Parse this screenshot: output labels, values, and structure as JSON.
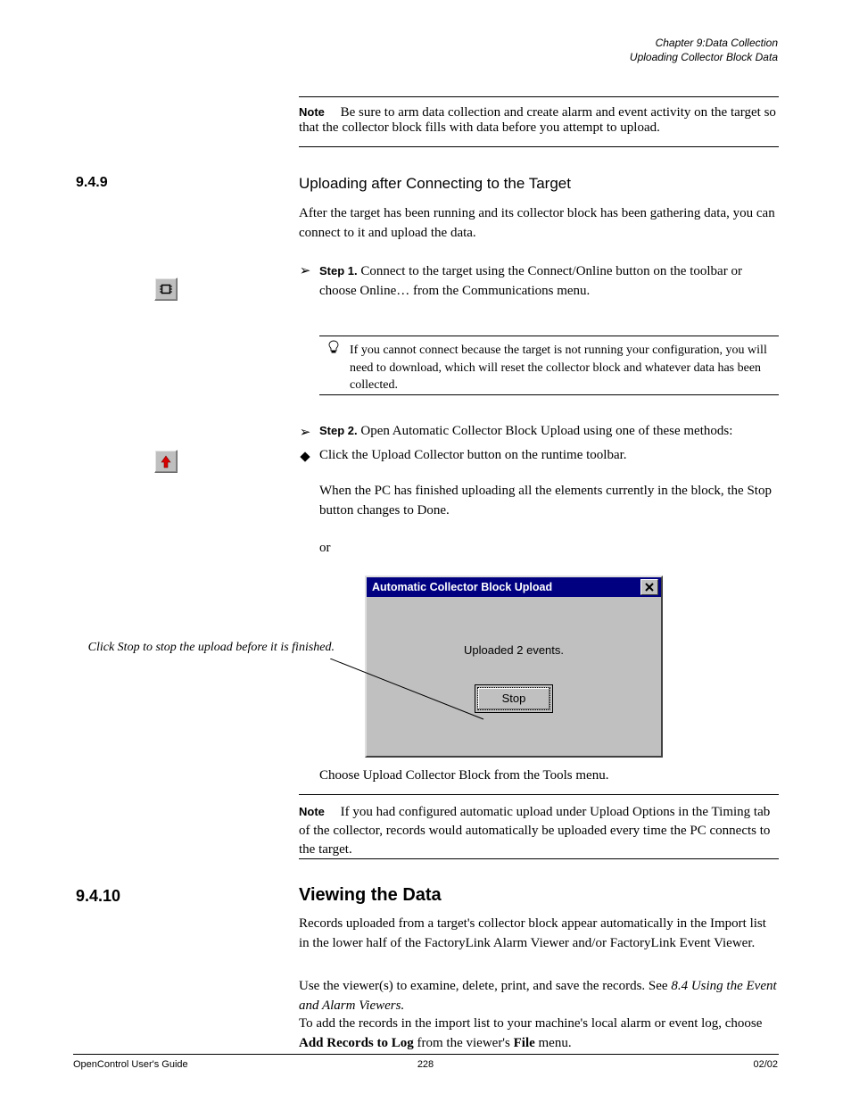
{
  "header": {
    "line1": "Chapter 9:Data Collection",
    "line2": "Uploading Collector Block Data"
  },
  "note1": {
    "label": "Note",
    "text": "Be sure to arm data collection and create alarm and event activity on the target so that the collector block fills with data before you attempt to upload."
  },
  "sec_949": {
    "number": "9.4.9",
    "title": "Uploading after Connecting to the Target",
    "intro": "After the target has been running and its collector block has been gathering data, you can connect to it and upload the data.",
    "step1_lead": "Step 1.",
    "step1_text": "Connect to the target using the Connect/Online button on the toolbar or choose Online… from the Communications menu.",
    "bulb_text": "If you cannot connect because the target is not running your configuration, you will need to download, which will reset the collector block and whatever data has been collected.",
    "step2_lead": "Step 2.",
    "step2_text": "Open Automatic Collector Block Upload using one of these methods:",
    "method1": "Click the Upload Collector button on the runtime toolbar.",
    "leader_text": "When the PC has finished uploading all the elements currently in the block, the Stop button changes to Done.",
    "or": "or",
    "choose": "Choose Upload Collector Block from the Tools menu."
  },
  "dialog": {
    "title": "Automatic Collector Block Upload",
    "message": "Uploaded 2 events.",
    "button": "Stop"
  },
  "callout": "Click Stop to stop the upload before it is finished.",
  "note2": {
    "label": "Note",
    "text": "If you had configured automatic upload under Upload Options in the Timing tab of the collector, records would automatically be uploaded every time the PC connects to the target."
  },
  "sec_9410": {
    "number": "9.4.10",
    "title": "Viewing the Data",
    "p1": "Records uploaded from a target's collector block appear automatically in the Import list in the lower half of the FactoryLink Alarm Viewer and/or FactoryLink Event Viewer.",
    "p2_a": "Use the viewer(s) to examine, delete, print, and save the records. See ",
    "p2_link": "8.4 Using the Event and Alarm Viewers.",
    "p3_a": "To add the records in the import list to your machine's local alarm or event log, choose ",
    "p3_b": "Add Records to Log",
    "p3_c": " from the viewer's ",
    "p3_d": "File",
    "p3_e": " menu."
  },
  "footer": {
    "left": "OpenControl User's Guide",
    "center": "228",
    "right": "02/02"
  }
}
